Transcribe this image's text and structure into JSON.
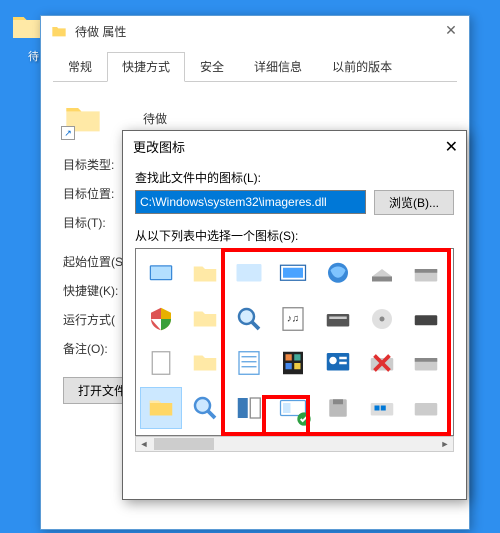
{
  "desktop": {
    "partial_label": "待"
  },
  "propWindow": {
    "title": "待做 属性",
    "tabs": [
      "常规",
      "快捷方式",
      "安全",
      "详细信息",
      "以前的版本"
    ],
    "activeTab": 1,
    "shortcutName": "待做",
    "rows": {
      "targetType": "目标类型:",
      "targetLoc": "目标位置:",
      "target": "目标(T):",
      "startIn": "起始位置(S",
      "hotkey": "快捷键(K):",
      "run": "运行方式(",
      "comment": "备注(O):"
    },
    "openFileBtn": "打开文件"
  },
  "iconDialog": {
    "title": "更改图标",
    "lookLabel": "查找此文件中的图标(L):",
    "path": "C:\\Windows\\system32\\imageres.dll",
    "browse": "浏览(B)...",
    "selectLabel": "从以下列表中选择一个图标(S):"
  }
}
